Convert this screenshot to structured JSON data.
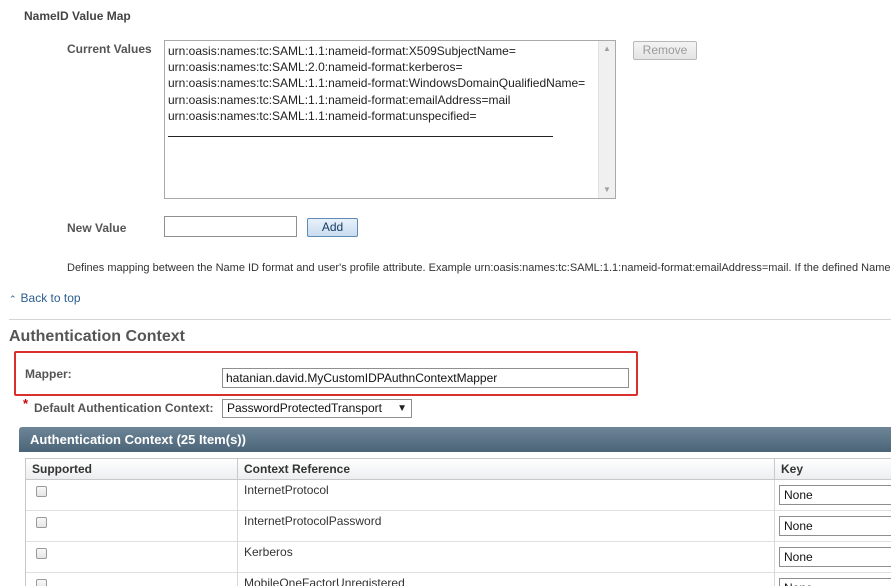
{
  "nameid": {
    "section_title": "NameID Value Map",
    "current_values_label": "Current Values",
    "values": [
      "urn:oasis:names:tc:SAML:1.1:nameid-format:X509SubjectName=",
      "urn:oasis:names:tc:SAML:2.0:nameid-format:kerberos=",
      "urn:oasis:names:tc:SAML:1.1:nameid-format:WindowsDomainQualifiedName=",
      "urn:oasis:names:tc:SAML:1.1:nameid-format:emailAddress=mail",
      "urn:oasis:names:tc:SAML:1.1:nameid-format:unspecified="
    ],
    "remove_label": "Remove",
    "new_value_label": "New Value",
    "new_value": "",
    "add_label": "Add",
    "help_text": "Defines mapping between the Name ID format and user's profile attribute. Example urn:oasis:names:tc:SAML:1.1:nameid-format:emailAddress=mail. If the defined Name ID f"
  },
  "back_to_top": "Back to top",
  "auth_context": {
    "title": "Authentication Context",
    "mapper_label": "Mapper:",
    "mapper_value": "hatanian.david.MyCustomIDPAuthnContextMapper",
    "required_mark": "*",
    "default_label": "Default Authentication Context:",
    "default_value": "PasswordProtectedTransport",
    "highlight_color": "#d9302d"
  },
  "table": {
    "title": "Authentication Context (25 Item(s))",
    "columns": [
      "Supported",
      "Context Reference",
      "Key"
    ],
    "rows": [
      {
        "reference": "InternetProtocol",
        "key": "None"
      },
      {
        "reference": "InternetProtocolPassword",
        "key": "None"
      },
      {
        "reference": "Kerberos",
        "key": "None"
      },
      {
        "reference": "MobileOneFactorUnregistered",
        "key": "None"
      }
    ]
  }
}
